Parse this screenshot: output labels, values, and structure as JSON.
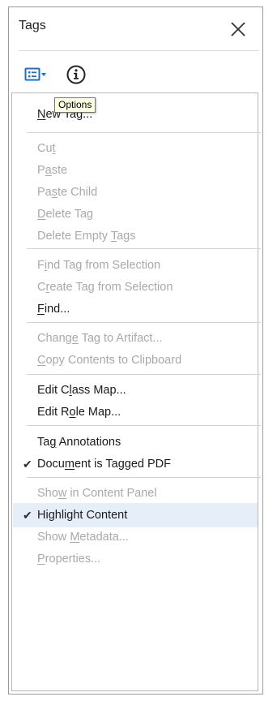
{
  "panel": {
    "title": "Tags",
    "close_icon": "close-icon",
    "options_icon": "options-list-icon",
    "info_icon": "info-circle-icon",
    "tooltip": "Options"
  },
  "menu": {
    "items": [
      {
        "label": "New Tag...",
        "ul": 0,
        "enabled": true
      },
      {
        "label": "Cut",
        "ul": 2,
        "enabled": false
      },
      {
        "label": "Paste",
        "ul": 1,
        "enabled": false
      },
      {
        "label": "Paste Child",
        "ul": 2,
        "enabled": false
      },
      {
        "label": "Delete Tag",
        "ul": 0,
        "enabled": false
      },
      {
        "label": "Delete Empty Tags",
        "ul": 13,
        "enabled": false
      },
      {
        "label": "Find Tag from Selection",
        "ul": 1,
        "enabled": false
      },
      {
        "label": "Create Tag from Selection",
        "ul": 1,
        "enabled": false
      },
      {
        "label": "Find...",
        "ul": 0,
        "enabled": true
      },
      {
        "label": "Change Tag to Artifact...",
        "ul": 5,
        "enabled": false
      },
      {
        "label": "Copy Contents to Clipboard",
        "ul": 0,
        "enabled": false
      },
      {
        "label": "Edit Class Map...",
        "ul": 6,
        "enabled": true
      },
      {
        "label": "Edit Role Map...",
        "ul": 6,
        "enabled": true
      },
      {
        "label": "Tag Annotations",
        "ul": 2,
        "enabled": true
      },
      {
        "label": "Document is Tagged PDF",
        "ul": 4,
        "enabled": true,
        "checked": true
      },
      {
        "label": "Show in Content Panel",
        "ul": 3,
        "enabled": false
      },
      {
        "label": "Highlight Content",
        "ul": -1,
        "enabled": true,
        "checked": true,
        "highlighted": true
      },
      {
        "label": "Show Metadata...",
        "ul": 5,
        "enabled": false
      },
      {
        "label": "Properties...",
        "ul": 0,
        "enabled": false
      }
    ],
    "check_mark": "✔"
  }
}
